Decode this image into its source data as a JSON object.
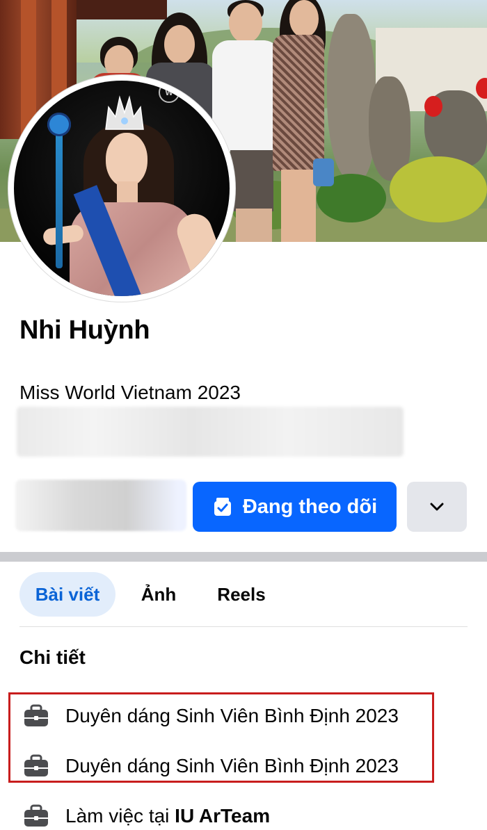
{
  "profile": {
    "name": "Nhi Huỳnh",
    "bio": "Miss World Vietnam 2023"
  },
  "actions": {
    "follow_label": "Đang theo dõi",
    "more_icon": "chevron-down-icon"
  },
  "tabs": [
    {
      "label": "Bài viết",
      "active": true
    },
    {
      "label": "Ảnh",
      "active": false
    },
    {
      "label": "Reels",
      "active": false
    }
  ],
  "details": {
    "title": "Chi tiết",
    "items": [
      {
        "icon": "briefcase-icon",
        "text": "Duyên dáng Sinh Viên Bình Định 2023"
      },
      {
        "icon": "briefcase-icon",
        "text": "Duyên dáng Sinh Viên Bình Định 2023"
      },
      {
        "icon": "briefcase-icon",
        "prefix": "Làm việc tại ",
        "bold": "IU ArTeam"
      }
    ]
  },
  "avatar": {
    "badge": "W"
  },
  "colors": {
    "accent": "#0866ff",
    "tab_active_bg": "#e2edfb",
    "tab_active_text": "#0a63d6",
    "highlight_border": "#c81d1d",
    "divider": "#cbccd0"
  }
}
